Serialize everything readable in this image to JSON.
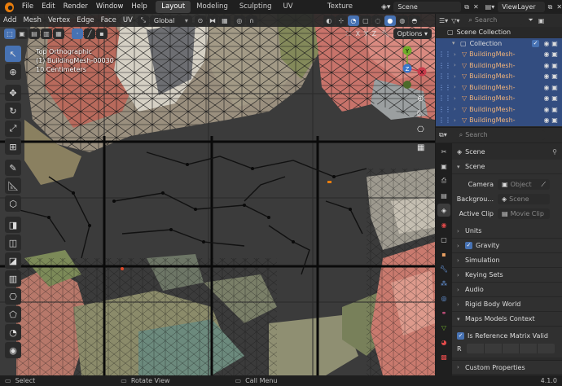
{
  "topbar": {
    "menus": [
      "File",
      "Edit",
      "Render",
      "Window",
      "Help"
    ],
    "workspaces": [
      "Layout",
      "Modeling",
      "Sculpting",
      "UV Editing",
      "Texture Paint"
    ],
    "active_workspace": "Layout",
    "scene": "Scene",
    "view_layer": "ViewLayer"
  },
  "viewport": {
    "header_menus": [
      "Add",
      "Mesh",
      "Vertex",
      "Edge",
      "Face",
      "UV"
    ],
    "transform_orientation": "Global",
    "axis_lock": [
      "X",
      "Y",
      "Z"
    ],
    "options_label": "Options",
    "overlay_lines": [
      "Top Orthographic",
      "(1) BuildingMesh-00030",
      "10 Centimeters"
    ],
    "gizmo_axes": [
      "Y",
      "Z",
      "X"
    ]
  },
  "outliner": {
    "search_placeholder": "Search",
    "root": "Scene Collection",
    "collection": "Collection",
    "items": [
      "BuildingMesh-",
      "BuildingMesh-",
      "BuildingMesh-",
      "BuildingMesh-",
      "BuildingMesh-",
      "BuildingMesh-",
      "BuildingMesh-"
    ]
  },
  "properties": {
    "search_placeholder": "Search",
    "context_title": "Scene",
    "scene_panel": {
      "title": "Scene",
      "camera_label": "Camera",
      "camera_placeholder": "Object",
      "background_label": "Backgrou...",
      "background_placeholder": "Scene",
      "active_clip_label": "Active Clip",
      "active_clip_placeholder": "Movie Clip"
    },
    "panels": [
      "Units",
      "Gravity",
      "Simulation",
      "Keying Sets",
      "Audio",
      "Rigid Body World",
      "Maps Models Context"
    ],
    "is_reference_label": "Is Reference Matrix Valid",
    "r_label": "R",
    "custom_properties": "Custom Properties"
  },
  "statusbar": {
    "select": "Select",
    "rotate": "Rotate View",
    "call_menu": "Call Menu",
    "version": "4.1.0"
  }
}
